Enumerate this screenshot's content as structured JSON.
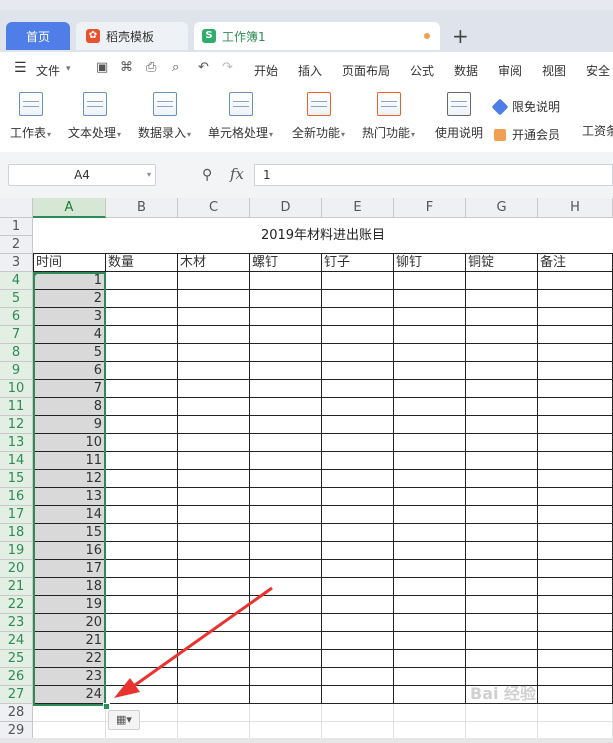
{
  "tabs": {
    "home": "首页",
    "template": "稻壳模板",
    "workbook": "工作簿1",
    "new_tab": "+"
  },
  "menu": {
    "file": "文件",
    "items": [
      "开始",
      "插入",
      "页面布局",
      "公式",
      "数据",
      "审阅",
      "视图",
      "安全"
    ]
  },
  "ribbon": {
    "buttons": [
      "工作表",
      "文本处理",
      "数据录入",
      "单元格处理",
      "全新功能",
      "热门功能",
      "使用说明"
    ],
    "limited_free": "限免说明",
    "vip": "开通会员",
    "more": "工资条"
  },
  "formula_bar": {
    "name_box": "A4",
    "fx": "fx",
    "value": "1"
  },
  "sheet": {
    "columns": [
      "A",
      "B",
      "C",
      "D",
      "E",
      "F",
      "G",
      "H"
    ],
    "selected_column": "A",
    "title": "2019年材料进出账目",
    "headers": [
      "时间",
      "数量",
      "木材",
      "螺钉",
      "钉子",
      "铆钉",
      "铜锭",
      "备注"
    ],
    "rows": [
      1,
      2,
      3,
      4,
      5,
      6,
      7,
      8,
      9,
      10,
      11,
      12,
      13,
      14,
      15,
      16,
      17,
      18,
      19,
      20,
      21,
      22,
      23,
      24,
      25,
      26,
      27,
      28,
      29
    ],
    "a_values": [
      "1",
      "2",
      "3",
      "4",
      "5",
      "6",
      "7",
      "8",
      "9",
      "10",
      "11",
      "12",
      "13",
      "14",
      "15",
      "16",
      "17",
      "18",
      "19",
      "20",
      "21",
      "22",
      "23",
      "24"
    ]
  },
  "watermark": "Bai 经验",
  "colors": {
    "accent_green": "#2e8b57",
    "home_tab": "#4f7ee8",
    "arrow_red": "#e8332e"
  }
}
